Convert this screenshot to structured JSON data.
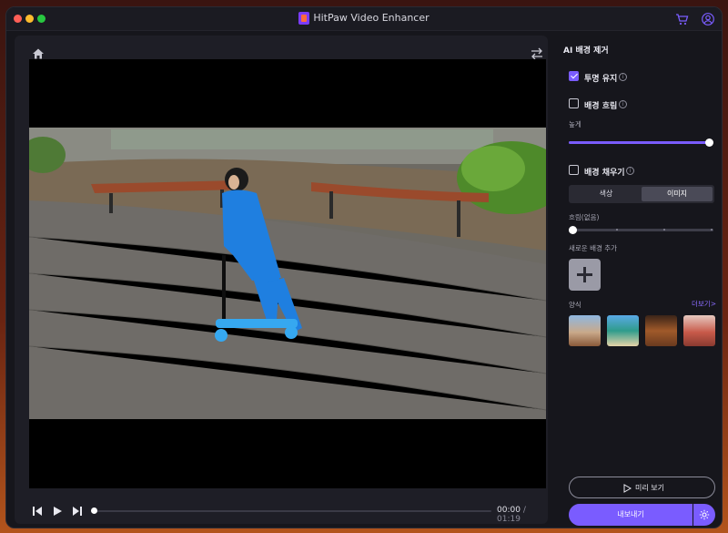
{
  "app": {
    "title": "HitPaw Video Enhancer"
  },
  "player": {
    "time_current": "00:00",
    "time_separator": "/",
    "time_total": "01:19",
    "progress": 0.0
  },
  "panel": {
    "title": "AI 배경 제거",
    "keep_transparent": {
      "label": "투명 유지",
      "checked": true
    },
    "blur_background": {
      "label": "배경 흐림",
      "checked": false
    },
    "height_label": "높게",
    "height_value": 1.0,
    "fill_background": {
      "label": "배경 채우기",
      "checked": false
    },
    "tabs": {
      "color": "색상",
      "image": "이미지",
      "selected": "image"
    },
    "blur_label": "흐림(없음)",
    "blur_value": 0.0,
    "new_background_label": "새로운 배경 추가",
    "style_label": "양식",
    "more_link": "더보기>",
    "preview_label": "미리 보기",
    "export_label": "내보내기"
  },
  "colors": {
    "accent": "#7a5cff",
    "window_bg": "#16161c",
    "pane_bg": "#1e1e26"
  }
}
